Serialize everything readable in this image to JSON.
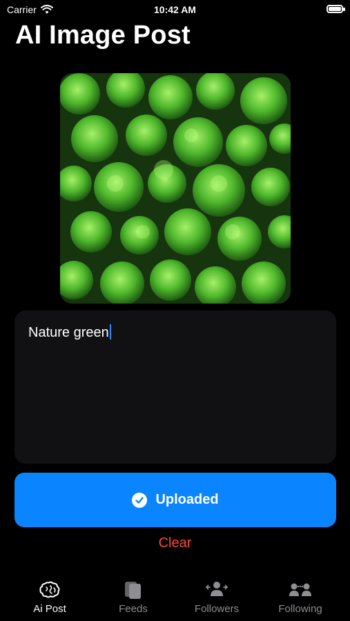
{
  "status_bar": {
    "carrier": "Carrier",
    "time": "10:42 AM"
  },
  "header": {
    "title": "AI Image Post"
  },
  "post": {
    "image_alt": "forest canopy",
    "text_value": "Nature green"
  },
  "actions": {
    "upload_label": "Uploaded",
    "clear_label": "Clear"
  },
  "tabs": [
    {
      "label": "Ai Post",
      "icon": "brain-icon",
      "active": true
    },
    {
      "label": "Feeds",
      "icon": "cards-icon",
      "active": false
    },
    {
      "label": "Followers",
      "icon": "followers-icon",
      "active": false
    },
    {
      "label": "Following",
      "icon": "following-icon",
      "active": false
    }
  ],
  "colors": {
    "accent": "#0A84FF",
    "clear": "#FF453A",
    "background": "#000000",
    "input_bg": "#111113"
  }
}
